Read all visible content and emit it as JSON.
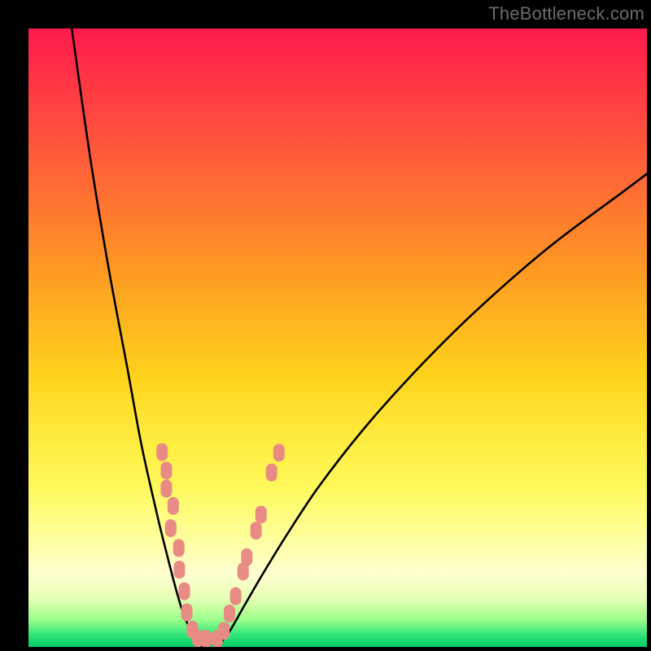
{
  "watermark": "TheBottleneck.com",
  "chart_data": {
    "type": "line",
    "title": "",
    "xlabel": "",
    "ylabel": "",
    "xlim": [
      0,
      100
    ],
    "ylim": [
      0,
      100
    ],
    "grid": false,
    "legend": false,
    "background_gradient_stops": [
      {
        "pct": 0,
        "color": "#ff1a4d"
      },
      {
        "pct": 10,
        "color": "#ff3a44"
      },
      {
        "pct": 20,
        "color": "#ff5a3a"
      },
      {
        "pct": 30,
        "color": "#ff7a2e"
      },
      {
        "pct": 40,
        "color": "#ff9d22"
      },
      {
        "pct": 56,
        "color": "#ffd21c"
      },
      {
        "pct": 65,
        "color": "#ffe93a"
      },
      {
        "pct": 74,
        "color": "#fff95a"
      },
      {
        "pct": 82,
        "color": "#ffff9a"
      },
      {
        "pct": 88,
        "color": "#ffffd0"
      },
      {
        "pct": 92,
        "color": "#e8ffb8"
      },
      {
        "pct": 95.5,
        "color": "#9fff8c"
      },
      {
        "pct": 98,
        "color": "#33e67a"
      },
      {
        "pct": 100,
        "color": "#00cc66"
      }
    ],
    "series": [
      {
        "name": "curve-left",
        "color": "#000000",
        "x": [
          7,
          10,
          13,
          16,
          18,
          19.5,
          21,
          22.5,
          23.8,
          25,
          26.3,
          27.2,
          28
        ],
        "y": [
          100,
          79,
          61,
          45,
          34,
          27,
          20.5,
          14.5,
          9.5,
          5.5,
          2.5,
          0.8,
          0
        ]
      },
      {
        "name": "curve-right",
        "color": "#000000",
        "x": [
          30.5,
          32.5,
          34.8,
          38,
          42,
          47,
          54,
          62,
          72,
          84,
          96,
          100
        ],
        "y": [
          0,
          2.5,
          6.5,
          12,
          18.5,
          26,
          35,
          44,
          54,
          64.5,
          73.5,
          76.5
        ]
      }
    ],
    "marker_points": {
      "name": "pink-dots",
      "shape": "rounded-pill",
      "color": "#e98b85",
      "points": [
        {
          "x": 21.6,
          "y": 31.5
        },
        {
          "x": 22.3,
          "y": 28.5
        },
        {
          "x": 22.3,
          "y": 25.6
        },
        {
          "x": 23.4,
          "y": 22.8
        },
        {
          "x": 23.0,
          "y": 19.2
        },
        {
          "x": 24.3,
          "y": 16.0
        },
        {
          "x": 24.4,
          "y": 12.5
        },
        {
          "x": 25.2,
          "y": 9.0
        },
        {
          "x": 25.6,
          "y": 5.6
        },
        {
          "x": 26.5,
          "y": 2.8
        },
        {
          "x": 27.4,
          "y": 1.4
        },
        {
          "x": 28.7,
          "y": 1.3
        },
        {
          "x": 30.5,
          "y": 1.3
        },
        {
          "x": 31.6,
          "y": 2.6
        },
        {
          "x": 32.5,
          "y": 5.4
        },
        {
          "x": 33.5,
          "y": 8.2
        },
        {
          "x": 34.7,
          "y": 12.2
        },
        {
          "x": 35.3,
          "y": 14.5
        },
        {
          "x": 36.8,
          "y": 18.8
        },
        {
          "x": 37.6,
          "y": 21.4
        },
        {
          "x": 39.3,
          "y": 28.2
        },
        {
          "x": 40.5,
          "y": 31.4
        }
      ]
    }
  }
}
